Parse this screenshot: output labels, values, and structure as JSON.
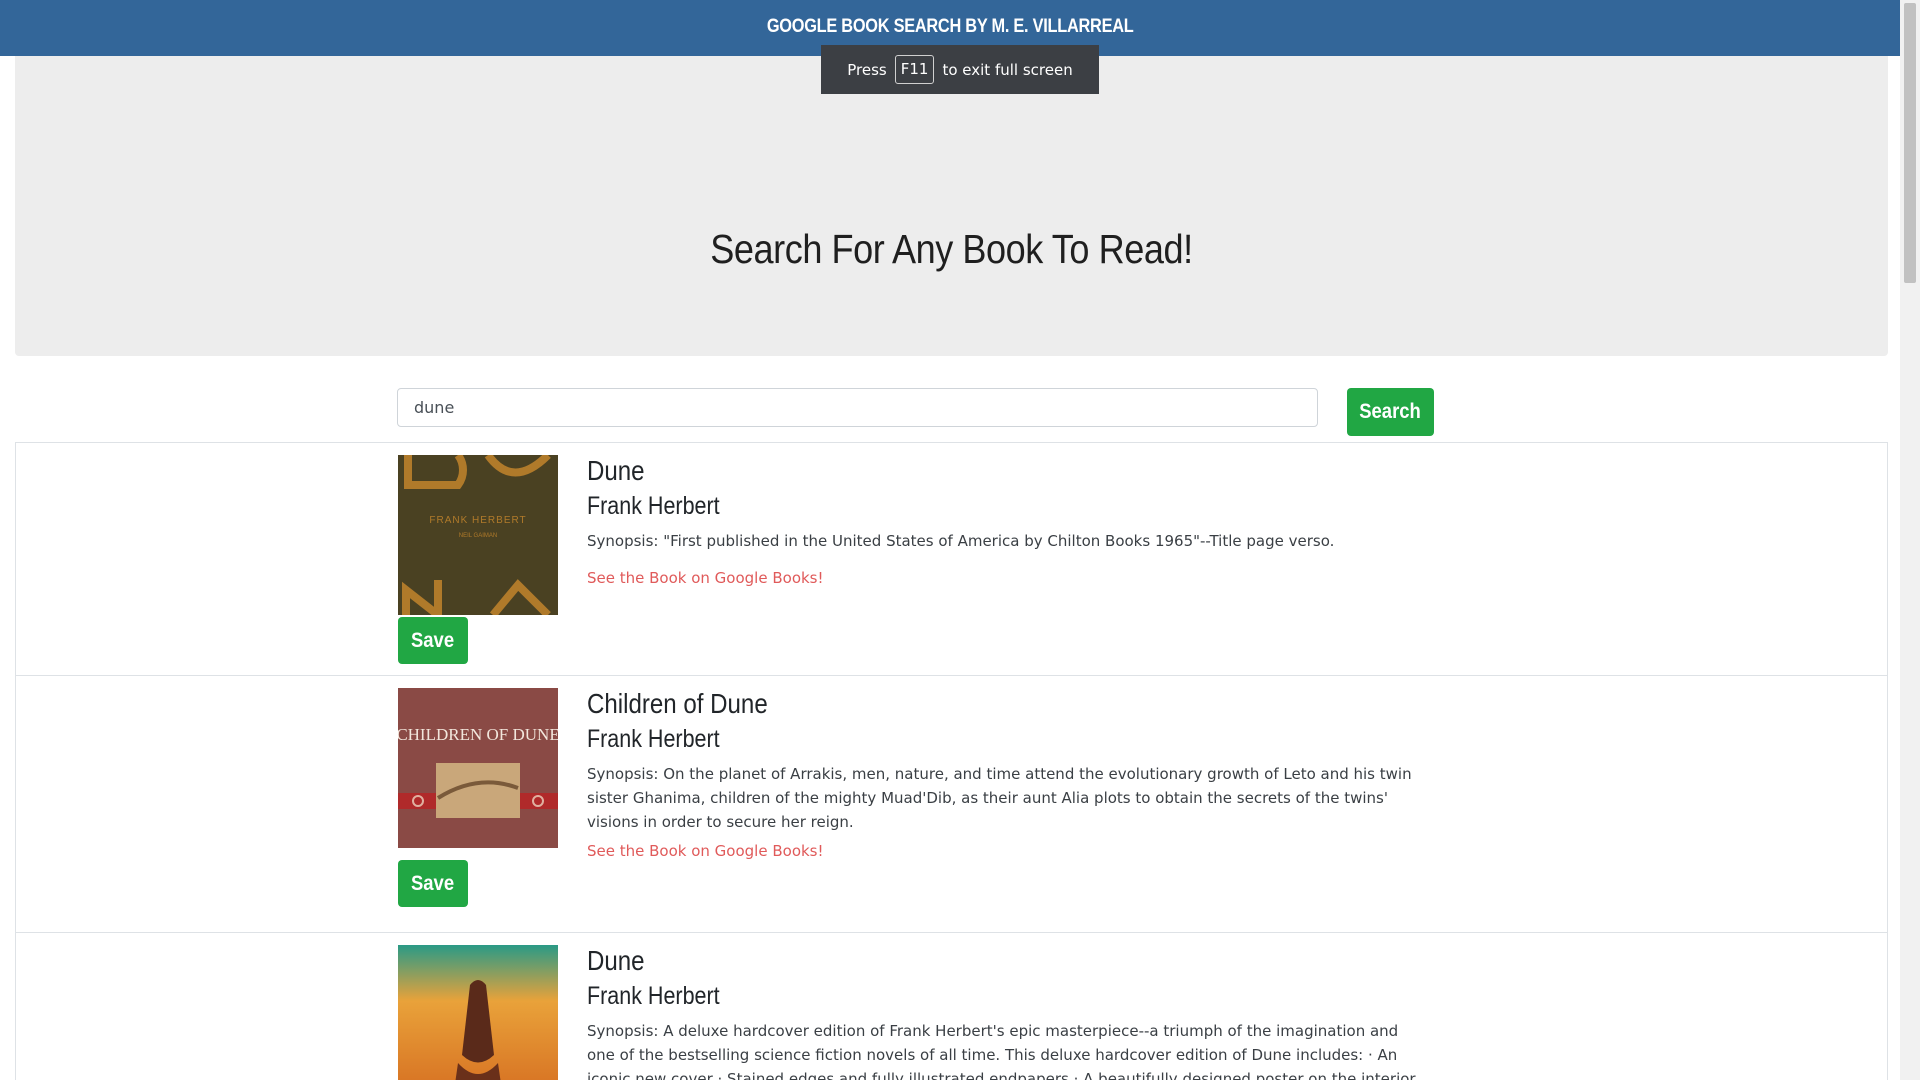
{
  "navbar": {
    "brand": "GOOGLE BOOK SEARCH BY M. E. VILLARREAL"
  },
  "fullscreen_notice": {
    "press": "Press",
    "key": "F11",
    "message": "to exit full screen"
  },
  "hero": {
    "title": "Search For Any Book To Read!"
  },
  "search": {
    "value": "dune",
    "button_label": "Search"
  },
  "results": [
    {
      "title": "Dune",
      "author": "Frank Herbert",
      "synopsis": "Synopsis: \"First published in the United States of America by Chilton Books 1965\"--Title page verso.",
      "link": "See the Book on Google Books!",
      "save": "Save",
      "cover_text": "FRANK HERBERT",
      "cover_subtext": "NEIL GAIMAN"
    },
    {
      "title": "Children of Dune",
      "author": "Frank Herbert",
      "synopsis": "Synopsis: On the planet of Arrakis, men, nature, and time attend the evolutionary growth of Leto and his twin sister Ghanima, children of the mighty Muad'Dib, as their aunt Alia plots to obtain the secrets of the twins' visions in order to secure her reign.",
      "link": "See the Book on Google Books!",
      "save": "Save",
      "cover_text": "CHILDREN OF DUNE"
    },
    {
      "title": "Dune",
      "author": "Frank Herbert",
      "synopsis": "Synopsis: A deluxe hardcover edition of Frank Herbert's epic masterpiece--a triumph of the imagination and one of the bestselling science fiction novels of all time. This deluxe hardcover edition of Dune includes: · An iconic new cover · Stained edges and fully illustrated endpapers · A beautifully designed poster on the interior of the jacket · A"
    }
  ],
  "colors": {
    "navbar": "#336699",
    "button": "#21a744",
    "link": "#e05a5a",
    "hero_bg": "#ededed"
  }
}
